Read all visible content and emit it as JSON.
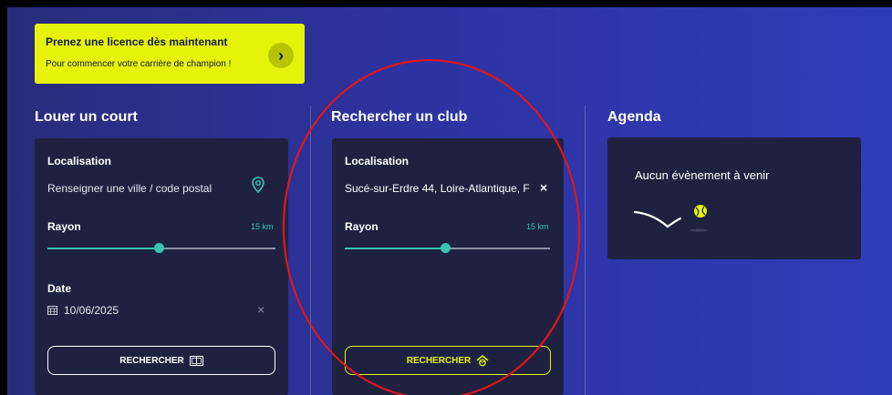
{
  "promo": {
    "title": "Prenez une licence dès maintenant",
    "subtitle": "Pour commencer votre carrière de champion !",
    "arrow": "›"
  },
  "court": {
    "heading": "Louer un court",
    "location_label": "Localisation",
    "location_placeholder": "Renseigner une ville / code postal",
    "radius_label": "Rayon",
    "radius_value": "15 km",
    "radius_fraction": 0.49,
    "date_label": "Date",
    "date_value": "10/06/2025",
    "clear": "×",
    "search_button": "RECHERCHER"
  },
  "club": {
    "heading": "Rechercher un club",
    "location_label": "Localisation",
    "location_value": "Sucé-sur-Erdre 44, Loire-Atlantique, F",
    "clear": "×",
    "radius_label": "Rayon",
    "radius_value": "15 km",
    "radius_fraction": 0.49,
    "search_button": "RECHERCHER"
  },
  "agenda": {
    "heading": "Agenda",
    "empty_text": "Aucun évènement à venir"
  },
  "colors": {
    "accent_yellow": "#e6f20a",
    "teal": "#35c5b0",
    "annotation_red": "#e0161b"
  }
}
